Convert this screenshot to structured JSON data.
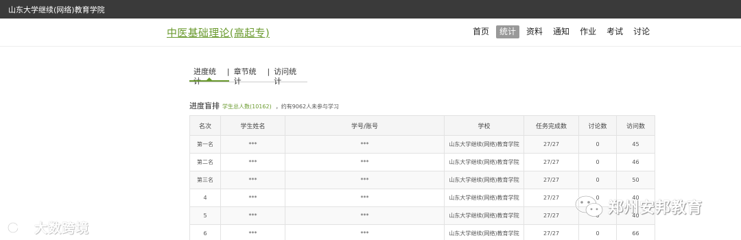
{
  "topbar": {
    "site_name": "山东大学继续(网络)教育学院"
  },
  "header": {
    "course_title": "中医基础理论(高起专)",
    "nav": [
      {
        "label": "首页",
        "active": false
      },
      {
        "label": "统计",
        "active": true
      },
      {
        "label": "资料",
        "active": false
      },
      {
        "label": "通知",
        "active": false
      },
      {
        "label": "作业",
        "active": false
      },
      {
        "label": "考试",
        "active": false
      },
      {
        "label": "讨论",
        "active": false
      }
    ]
  },
  "subtabs": {
    "items": [
      "进度统计",
      "章节统计",
      "访问统计"
    ],
    "separator": "|",
    "active_index": 0
  },
  "ranking": {
    "title": "进度盲排",
    "total": "学生总人数(10162)",
    "note": "，约有9062人未参与学习"
  },
  "table": {
    "columns": [
      "名次",
      "学生姓名",
      "学号/账号",
      "学校",
      "任务完成数",
      "讨论数",
      "访问数"
    ],
    "rows": [
      [
        "第一名",
        "***",
        "***",
        "山东大学继续(网络)教育学院",
        "27/27",
        "0",
        "45"
      ],
      [
        "第二名",
        "***",
        "***",
        "山东大学继续(网络)教育学院",
        "27/27",
        "0",
        "46"
      ],
      [
        "第三名",
        "***",
        "***",
        "山东大学继续(网络)教育学院",
        "27/27",
        "0",
        "50"
      ],
      [
        "4",
        "***",
        "***",
        "山东大学继续(网络)教育学院",
        "27/27",
        "0",
        "40"
      ],
      [
        "5",
        "***",
        "***",
        "山东大学继续(网络)教育学院",
        "27/27",
        "0",
        "40"
      ],
      [
        "6",
        "***",
        "***",
        "山东大学继续(网络)教育学院",
        "27/27",
        "0",
        "66"
      ]
    ]
  },
  "watermarks": {
    "left": "大数跨境",
    "right": "郑州安邦教育"
  },
  "colors": {
    "accent": "#6a9a2e",
    "topbar": "#3a3a3a",
    "active_nav": "#999999"
  }
}
